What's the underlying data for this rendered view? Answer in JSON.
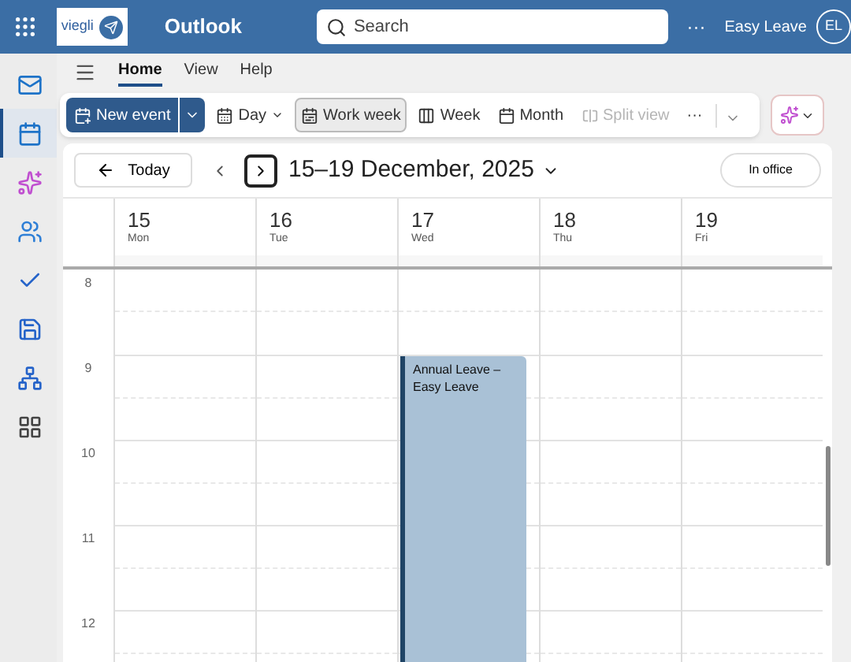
{
  "top_bar": {
    "brand_logo_text": "viegli",
    "app_name": "Outlook",
    "search": {
      "placeholder": "Search"
    },
    "more": "···",
    "user_name": "Easy Leave",
    "avatar_initials": "EL"
  },
  "nav_rail": [
    {
      "selected": false
    },
    {
      "selected": true
    },
    {
      "selected": false
    },
    {
      "selected": false
    },
    {
      "selected": false
    },
    {
      "selected": false
    },
    {
      "selected": false
    },
    {
      "selected": false
    }
  ],
  "ribbon_tabs": [
    {
      "label": "Home",
      "selected": true
    },
    {
      "label": "View",
      "selected": false
    },
    {
      "label": "Help",
      "selected": false
    }
  ],
  "toolbar": {
    "new_event": "New event",
    "views": [
      {
        "kind": "day",
        "label": "Day",
        "selected": false,
        "disabled": false
      },
      {
        "kind": "work_week",
        "label": "Work week",
        "selected": true,
        "disabled": false
      },
      {
        "kind": "week",
        "label": "Week",
        "selected": false,
        "disabled": false
      },
      {
        "kind": "month",
        "label": "Month",
        "selected": false,
        "disabled": false
      },
      {
        "kind": "split",
        "label": "Split view",
        "selected": false,
        "disabled": true
      }
    ],
    "more": "···"
  },
  "calendar": {
    "today_button": "Today",
    "range_title": "15–19 December, 2025",
    "status_button": "In office",
    "days": [
      {
        "date": "15",
        "weekday": "Mon"
      },
      {
        "date": "16",
        "weekday": "Tue"
      },
      {
        "date": "17",
        "weekday": "Wed",
        "events": [
          {
            "title": "Annual Leave – Easy Leave"
          }
        ]
      },
      {
        "date": "18",
        "weekday": "Thu"
      },
      {
        "date": "19",
        "weekday": "Fri"
      }
    ],
    "hours": [
      {
        "label": "8"
      },
      {
        "label": "9"
      },
      {
        "label": "10"
      },
      {
        "label": "11"
      },
      {
        "label": "12"
      }
    ]
  }
}
